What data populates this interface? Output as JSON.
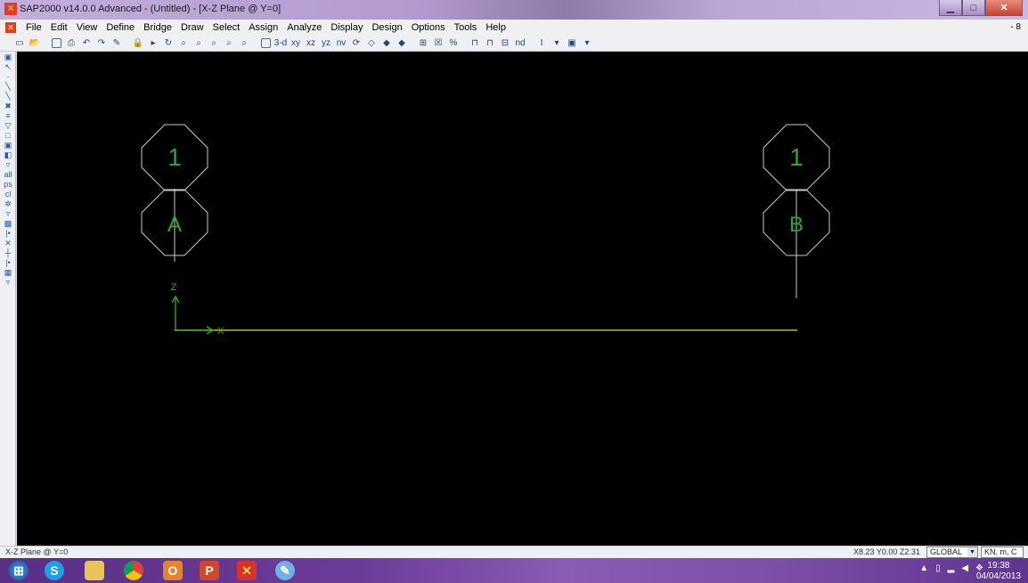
{
  "window": {
    "title": "SAP2000 v14.0.0 Advanced  - (Untitled) - [X-Z Plane @ Y=0]",
    "app_icon": "sap2000-logo-icon",
    "controls": [
      "minimize-icon",
      "maximize-icon",
      "close-icon"
    ],
    "restore_label": "- 8"
  },
  "menu": {
    "items": [
      "File",
      "Edit",
      "View",
      "Define",
      "Bridge",
      "Draw",
      "Select",
      "Assign",
      "Analyze",
      "Display",
      "Design",
      "Options",
      "Tools",
      "Help"
    ]
  },
  "toolbar": {
    "icons": [
      "new-icon",
      "open-icon",
      "save-icon",
      "print-icon",
      "undo-icon",
      "redo-icon",
      "pencil-icon",
      "lock-icon",
      "run-icon",
      "refresh-icon",
      "zoom-window-icon",
      "zoom-in-icon",
      "zoom-out-icon",
      "zoom-full-icon",
      "zoom-previous-icon",
      "view-3d-icon",
      "view-xy-icon",
      "view-xz-icon",
      "view-yz-icon",
      "view-nv-icon",
      "rotate-icon",
      "perspective-icon",
      "up-icon",
      "down-icon",
      "object-shrink-icon",
      "set-display-icon",
      "grid-icon",
      "joint-icon",
      "frame-icon",
      "moment-icon",
      "text-icon",
      "dropdown-icon"
    ],
    "text_buttons": [
      "3-d",
      "xy",
      "xz",
      "yz",
      "nv",
      "nd"
    ]
  },
  "left_toolbar": {
    "icons": [
      "pointer-icon",
      "reshape-icon",
      "dot-icon",
      "frame-draw-icon",
      "frame-quick-icon",
      "brace-icon",
      "cable-icon",
      "area-draw-icon",
      "rect-area-icon",
      "quick-area-icon",
      "solid-icon",
      "link-icon",
      "section-cut-icon",
      "all-select-icon",
      "clear-select-icon",
      "snap-icon",
      "snap-end-icon",
      "snap-mid-icon",
      "snap-intersect-icon",
      "snap-perp-icon",
      "snap-line-icon",
      "snap-grid-icon"
    ],
    "labels": [
      "all",
      "ps",
      "cl"
    ]
  },
  "drawing": {
    "grid_bubbles": [
      {
        "label": "1",
        "id": "grid-1-left"
      },
      {
        "label": "A",
        "id": "grid-a"
      },
      {
        "label": "1",
        "id": "grid-1-right"
      },
      {
        "label": "B",
        "id": "grid-b"
      }
    ],
    "axis_labels": {
      "z": "Z",
      "x": "X"
    },
    "colors": {
      "background": "#000000",
      "grid_line": "#c8c8c8",
      "bubble_outline": "#c8c8c8",
      "bubble_text": "#2ea62e",
      "axis": "#28b428",
      "frame": "#b4b432"
    }
  },
  "status": {
    "view_label": "X-Z Plane @ Y=0",
    "coords": "X8.23  Y0.00  Z2.31",
    "coord_system": "GLOBAL",
    "units": "KN, m, C"
  },
  "taskbar": {
    "items": [
      "windows-start-icon",
      "skype-icon",
      "file-explorer-icon",
      "chrome-icon",
      "outlook-icon",
      "powerpoint-icon",
      "sap2000-icon",
      "paint-icon"
    ],
    "tray": [
      "up-arrow-icon",
      "flag-icon",
      "network-icon",
      "volume-icon",
      "dropbox-icon"
    ],
    "time": "19:38",
    "date": "04/04/2013"
  }
}
